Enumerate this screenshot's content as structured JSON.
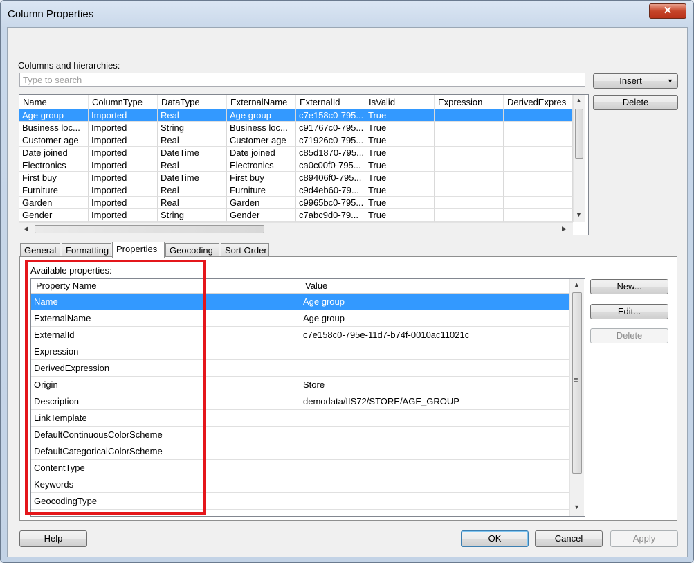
{
  "window": {
    "title": "Column Properties",
    "close_glyph": "✕"
  },
  "columns_label": "Columns and hierarchies:",
  "search": {
    "placeholder": "Type to search",
    "value": ""
  },
  "buttons": {
    "insert": "Insert",
    "delete_top": "Delete",
    "new": "New...",
    "edit": "Edit...",
    "delete_props": "Delete",
    "help": "Help",
    "ok": "OK",
    "cancel": "Cancel",
    "apply": "Apply"
  },
  "columns_table": {
    "headers": [
      "Name",
      "ColumnType",
      "DataType",
      "ExternalName",
      "ExternalId",
      "IsValid",
      "Expression",
      "DerivedExpres"
    ],
    "rows": [
      [
        "Age group",
        "Imported",
        "Real",
        "Age group",
        "c7e158c0-795...",
        "True",
        "",
        ""
      ],
      [
        "Business loc...",
        "Imported",
        "String",
        "Business loc...",
        "c91767c0-795...",
        "True",
        "",
        ""
      ],
      [
        "Customer age",
        "Imported",
        "Real",
        "Customer age",
        "c71926c0-795...",
        "True",
        "",
        ""
      ],
      [
        "Date joined",
        "Imported",
        "DateTime",
        "Date joined",
        "c85d1870-795...",
        "True",
        "",
        ""
      ],
      [
        "Electronics",
        "Imported",
        "Real",
        "Electronics",
        "ca0c00f0-795...",
        "True",
        "",
        ""
      ],
      [
        "First buy",
        "Imported",
        "DateTime",
        "First buy",
        "c89406f0-795...",
        "True",
        "",
        ""
      ],
      [
        "Furniture",
        "Imported",
        "Real",
        "Furniture",
        "c9d4eb60-79...",
        "True",
        "",
        ""
      ],
      [
        "Garden",
        "Imported",
        "Real",
        "Garden",
        "c9965bc0-795...",
        "True",
        "",
        ""
      ],
      [
        "Gender",
        "Imported",
        "String",
        "Gender",
        "c7abc9d0-79...",
        "True",
        "",
        ""
      ]
    ]
  },
  "tabs": [
    "General",
    "Formatting",
    "Properties",
    "Geocoding",
    "Sort Order"
  ],
  "available_label": "Available properties:",
  "properties_table": {
    "headers": [
      "Property Name",
      "Value"
    ],
    "rows": [
      [
        "Name",
        "Age group"
      ],
      [
        "ExternalName",
        "Age group"
      ],
      [
        "ExternalId",
        "c7e158c0-795e-11d7-b74f-0010ac11021c"
      ],
      [
        "Expression",
        ""
      ],
      [
        "DerivedExpression",
        ""
      ],
      [
        "Origin",
        "Store"
      ],
      [
        "Description",
        "demodata/IIS72/STORE/AGE_GROUP"
      ],
      [
        "LinkTemplate",
        ""
      ],
      [
        "DefaultContinuousColorScheme",
        ""
      ],
      [
        "DefaultCategoricalColorScheme",
        ""
      ],
      [
        "ContentType",
        ""
      ],
      [
        "Keywords",
        ""
      ],
      [
        "GeocodingType",
        ""
      ]
    ]
  },
  "selected_column_row": 0,
  "selected_property_row": 0,
  "active_tab": 2,
  "colors": {
    "selection": "#3399ff",
    "highlight_box": "#e4161b"
  },
  "icons": {
    "dropdown": "▼",
    "scroll_up": "▲",
    "scroll_down": "▼",
    "scroll_left": "◀",
    "scroll_right": "▶",
    "grip": "≡"
  }
}
